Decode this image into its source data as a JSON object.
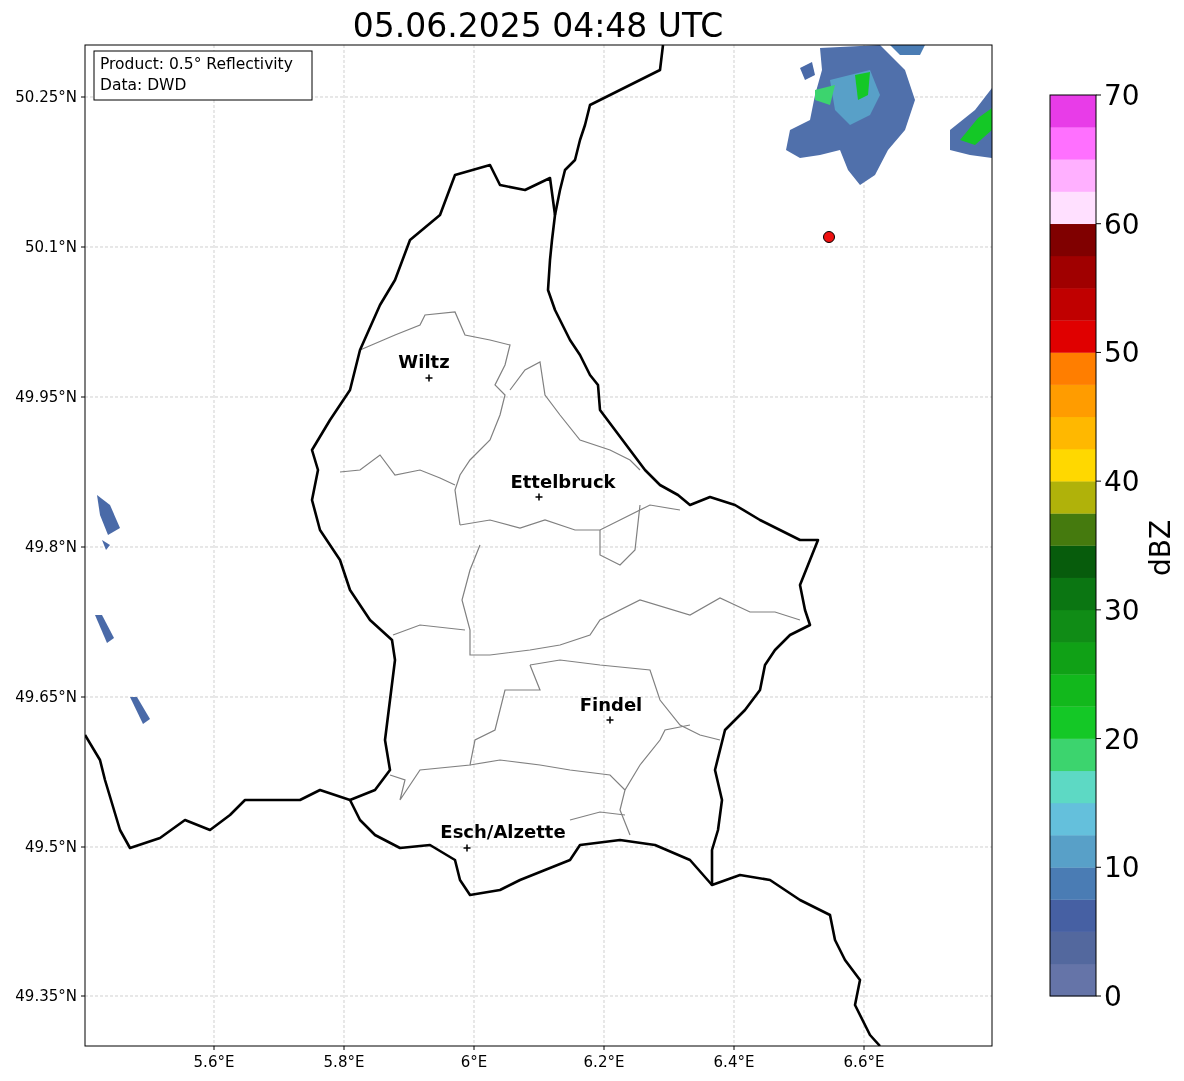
{
  "title": "05.06.2025 04:48 UTC",
  "info_box": [
    "Product: 0.5° Reflectivity",
    "Data: DWD"
  ],
  "x_ticks": [
    "5.6°E",
    "5.8°E",
    "6°E",
    "6.2°E",
    "6.4°E",
    "6.6°E"
  ],
  "y_ticks": [
    "50.25°N",
    "50.1°N",
    "49.95°N",
    "49.8°N",
    "49.65°N",
    "49.5°N",
    "49.35°N"
  ],
  "cities": [
    {
      "name": "Wiltz"
    },
    {
      "name": "Ettelbruck"
    },
    {
      "name": "Findel"
    },
    {
      "name": "Esch/Alzette"
    }
  ],
  "colorbar": {
    "label": "dBZ",
    "ticks": [
      "70",
      "60",
      "50",
      "40",
      "30",
      "20",
      "10",
      "0"
    ],
    "bins": [
      {
        "color": "#6574a8"
      },
      {
        "color": "#53689e"
      },
      {
        "color": "#4660a3"
      },
      {
        "color": "#4a7cb4"
      },
      {
        "color": "#58a0c8"
      },
      {
        "color": "#64c0dc"
      },
      {
        "color": "#5dd9c4"
      },
      {
        "color": "#3cd46e"
      },
      {
        "color": "#14c826"
      },
      {
        "color": "#12b81c"
      },
      {
        "color": "#10a116"
      },
      {
        "color": "#108c16"
      },
      {
        "color": "#0b7612"
      },
      {
        "color": "#075c0c"
      },
      {
        "color": "#457a0e"
      },
      {
        "color": "#b0b20a"
      },
      {
        "color": "#ffd800"
      },
      {
        "color": "#ffb800"
      },
      {
        "color": "#ff9c00"
      },
      {
        "color": "#ff7e00"
      },
      {
        "color": "#e00000"
      },
      {
        "color": "#c00000"
      },
      {
        "color": "#a00000"
      },
      {
        "color": "#800000"
      },
      {
        "color": "#ffe0ff"
      },
      {
        "color": "#ffb0ff"
      },
      {
        "color": "#ff70ff"
      },
      {
        "color": "#e83ce8"
      }
    ]
  }
}
